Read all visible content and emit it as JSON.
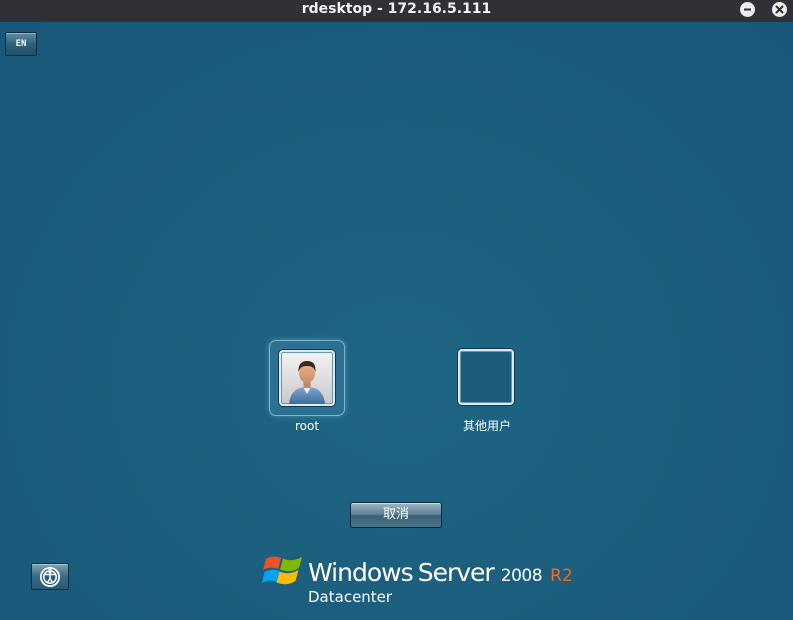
{
  "window": {
    "title": "rdesktop - 172.16.5.111"
  },
  "language": {
    "indicator": "EN"
  },
  "users": [
    {
      "name": "root"
    },
    {
      "name": "其他用户"
    }
  ],
  "actions": {
    "cancel_label": "取消"
  },
  "branding": {
    "product_windows": "Windows",
    "product_server": "Server",
    "version": "2008",
    "release": "R2",
    "edition": "Datacenter"
  },
  "colors": {
    "background": "#1c5b7a",
    "titlebar": "#2f3136",
    "r2_accent": "#f06a24"
  },
  "icons": {
    "minimize": "minimize-icon",
    "close": "close-icon",
    "user_avatar": "user-avatar-icon",
    "ease_of_access": "ease-of-access-icon",
    "windows_logo": "windows-flag-logo"
  }
}
